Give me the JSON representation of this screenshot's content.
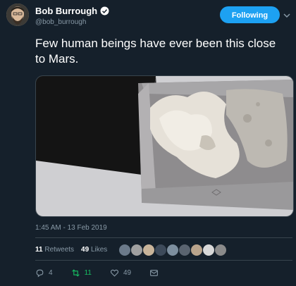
{
  "user": {
    "display_name": "Bob Burrough",
    "handle": "@bob_burrough",
    "verified": true
  },
  "follow_button": {
    "label": "Following"
  },
  "tweet": {
    "text": "Few human beings have ever been this close to Mars.",
    "timestamp": "1:45 AM - 13 Feb 2019"
  },
  "stats": {
    "retweets_count": "11",
    "retweets_label": "Retweets",
    "likes_count": "49",
    "likes_label": "Likes"
  },
  "actions": {
    "reply_count": "4",
    "retweet_count": "11",
    "like_count": "49"
  },
  "colors": {
    "background": "#15202b",
    "accent": "#1da1f2",
    "secondary_text": "#8899a6",
    "retweet_green": "#17bf63",
    "divider": "#38444d"
  },
  "icons": {
    "verified": "verified-badge-icon",
    "chevron": "chevron-down-icon",
    "reply": "reply-icon",
    "retweet": "retweet-icon",
    "like": "heart-icon",
    "dm": "envelope-icon"
  }
}
